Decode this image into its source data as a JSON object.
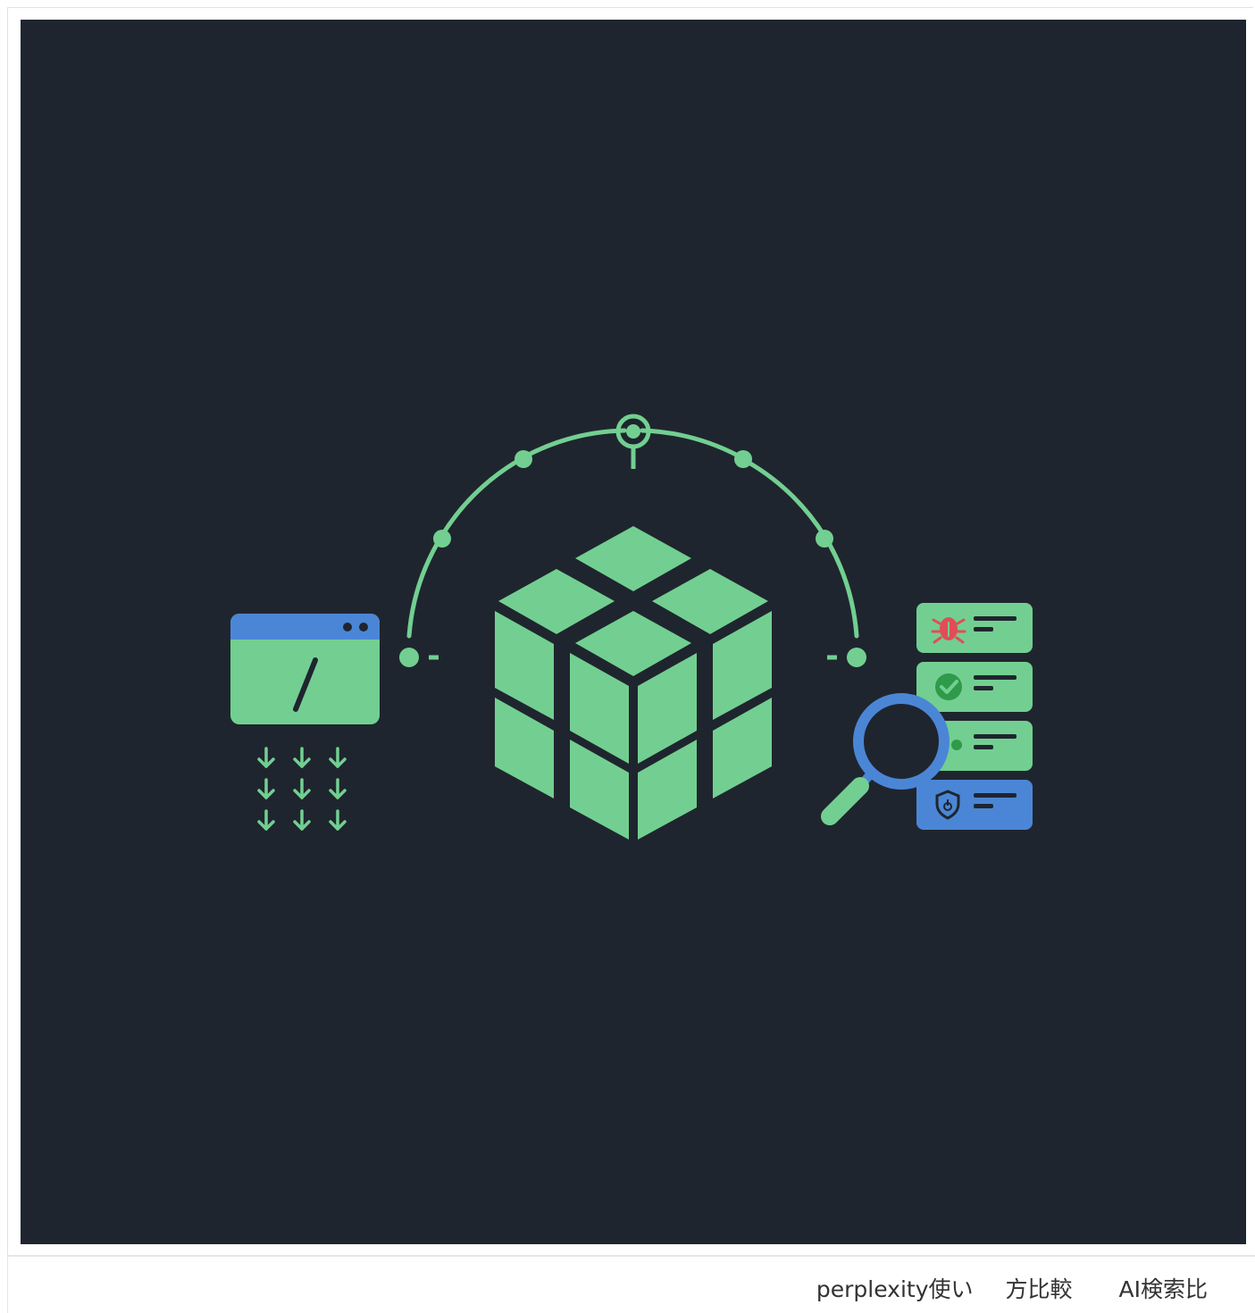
{
  "illustration": {
    "colors": {
      "background": "#1f252e",
      "green": "#72cf91",
      "blue": "#4b86d6",
      "red": "#e14d56",
      "dark_green": "#2e9a4a"
    },
    "icons": [
      "code-window-icon",
      "download-arrows-icon",
      "cube-icon",
      "orbit-arc-icon",
      "magnifier-icon",
      "report-cards-icon",
      "bug-icon",
      "check-icon",
      "shield-icon"
    ]
  },
  "footer": {
    "tags": [
      "perplexity使い",
      "方比較",
      "AI検索比"
    ]
  }
}
